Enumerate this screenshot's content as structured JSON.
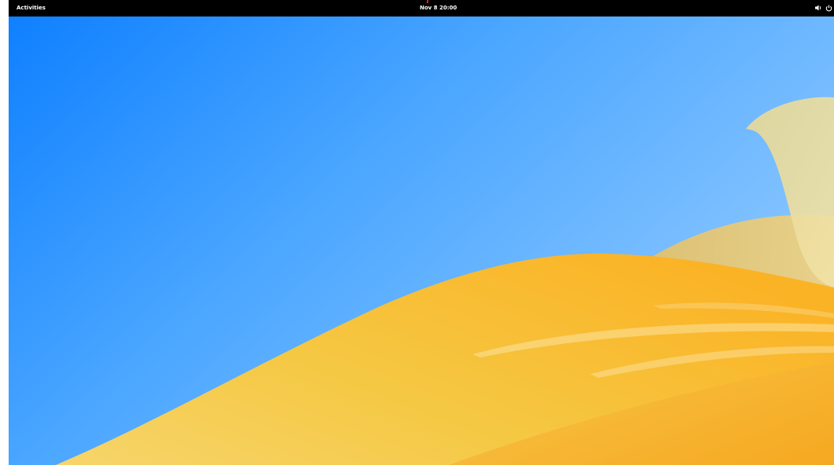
{
  "top_bar": {
    "activities_label": "Activities",
    "clock_label": "Nov 8  20:00",
    "status_icons": [
      "volume-icon",
      "power-icon"
    ]
  },
  "wallpaper": {
    "sky_colors": [
      "#1a87ff",
      "#5fb1ff",
      "#8ec8ff"
    ],
    "dune_colors": [
      "#f5c843",
      "#fbb023",
      "#f6a019"
    ],
    "shape_color": "#ecdca2"
  }
}
